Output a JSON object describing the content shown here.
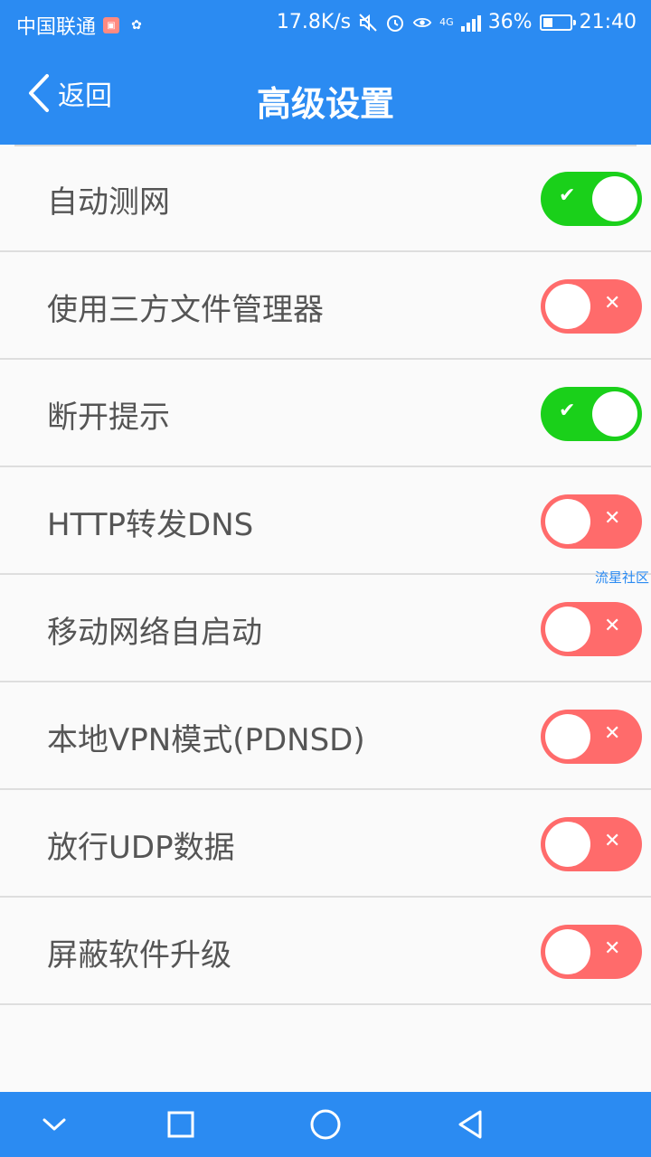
{
  "status_bar": {
    "carrier": "中国联通",
    "speed": "17.8K/s",
    "network": "4G",
    "battery": "36%",
    "time": "21:40"
  },
  "header": {
    "back_label": "返回",
    "title": "高级设置"
  },
  "settings": [
    {
      "label": "自动测网",
      "on": true
    },
    {
      "label": "使用三方文件管理器",
      "on": false
    },
    {
      "label": "断开提示",
      "on": true
    },
    {
      "label": "HTTP转发DNS",
      "on": false
    },
    {
      "label": "移动网络自启动",
      "on": false
    },
    {
      "label": "本地VPN模式(PDNSD)",
      "on": false
    },
    {
      "label": "放行UDP数据",
      "on": false
    },
    {
      "label": "屏蔽软件升级",
      "on": false
    }
  ],
  "watermark": "流星社区",
  "colors": {
    "header": "#2b8bf2",
    "toggle_on": "#1ad01a",
    "toggle_off": "#ff6b6b"
  }
}
